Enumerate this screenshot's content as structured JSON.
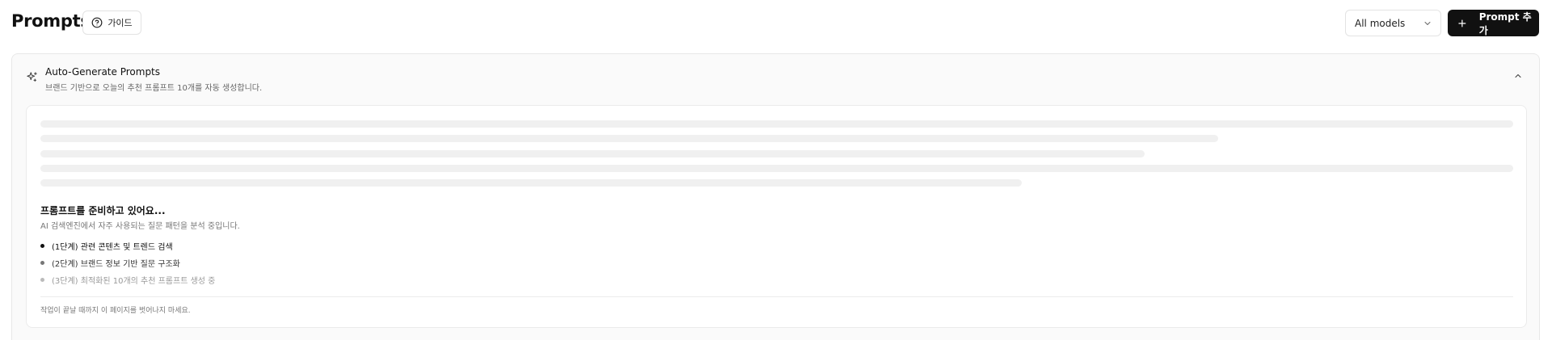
{
  "header": {
    "title": "Prompts",
    "guide_label": "가이드",
    "model_select": {
      "value": "All models"
    },
    "add_button_label": "Prompt 추가"
  },
  "panel": {
    "title": "Auto-Generate Prompts",
    "subtitle": "브랜드 기반으로 오늘의 추천 프롬프트 10개를 자동 생성합니다.",
    "expanded": true,
    "loading": {
      "title": "프롬프트를 준비하고 있어요...",
      "description": "AI 검색엔진에서 자주 사용되는 질문 패턴을 분석 중입니다.",
      "steps": [
        {
          "label": "(1단계) 관련 콘텐츠 및 트렌드 검색",
          "status": "active"
        },
        {
          "label": "(2단계) 브랜드 정보 기반 질문 구조화",
          "status": "pending"
        },
        {
          "label": "(3단계) 최적화된 10개의 추천 프롬프트 생성 중",
          "status": "waiting"
        }
      ],
      "footer_note": "작업이 끝날 때까지 이 페이지를 벗어나지 마세요."
    }
  },
  "icons": {
    "guide": "help-circle-icon",
    "select_chevron": "chevron-down-icon",
    "add": "plus-icon",
    "panel": "sparkles-icon",
    "collapse": "chevron-up-icon"
  },
  "colors": {
    "primary_button": "#111111",
    "panel_background": "#fafafa",
    "skeleton": "#f0f0f0"
  }
}
